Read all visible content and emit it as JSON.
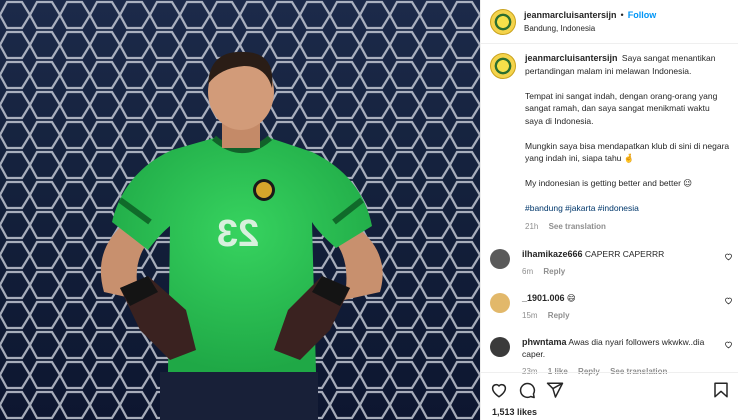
{
  "post": {
    "username": "jeanmarcluisantersijn",
    "follow_label": "Follow",
    "location": "Bandung, Indonesia"
  },
  "caption": {
    "username": "jeanmarcluisantersijn",
    "p1": "Saya sangat menantikan pertandingan malam ini melawan Indonesia.",
    "p2": "Tempat ini sangat indah, dengan orang-orang yang sangat ramah, dan saya sangat menikmati waktu saya di Indonesia.",
    "p3": "Mungkin saya bisa mendapatkan klub di sini di negara yang indah ini, siapa tahu 🤞",
    "p4": "My indonesian is getting better and better 😉",
    "hashtags": "#bandung #jakarta #indonesia",
    "time": "21h",
    "see_translation": "See translation"
  },
  "comments": [
    {
      "username": "ilhamikaze666",
      "text": "CAPERR CAPERRR",
      "time": "6m",
      "likes": "",
      "reply": "Reply",
      "see_translation": "",
      "avatar_color": "#5a5a5a"
    },
    {
      "username": "_1901.006",
      "text": "😄",
      "time": "15m",
      "likes": "",
      "reply": "Reply",
      "see_translation": "",
      "avatar_color": "#e2b86a"
    },
    {
      "username": "phwntama",
      "text": "Awas dia nyari followers wkwkw..dia caper.",
      "time": "23m",
      "likes": "1 like",
      "reply": "Reply",
      "see_translation": "See translation",
      "avatar_color": "#3b3b3b"
    }
  ],
  "jersey_number": "23",
  "likes_count": "1,513 likes",
  "icons": [
    "heart-icon",
    "comment-icon",
    "share-icon",
    "bookmark-icon"
  ]
}
